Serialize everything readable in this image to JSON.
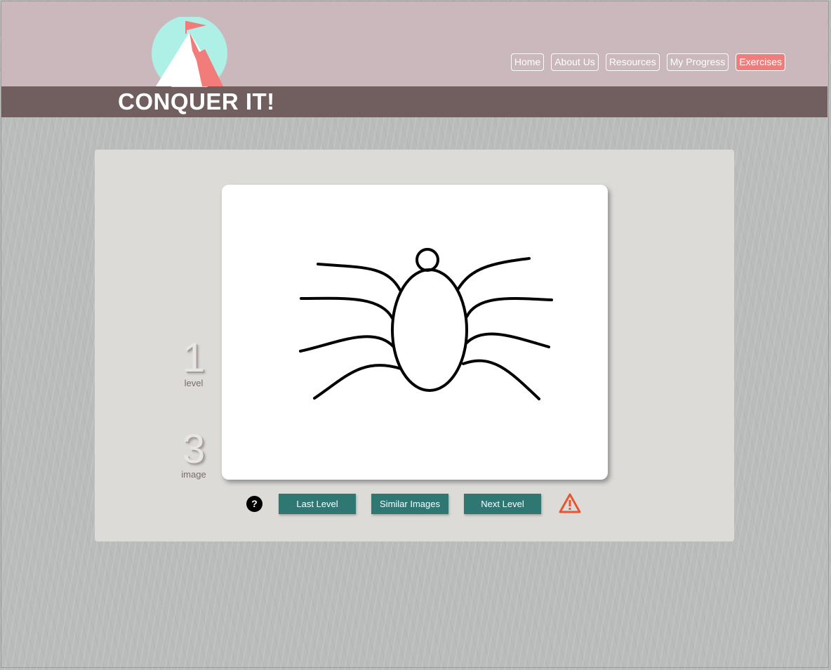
{
  "brand": {
    "name": "CONQUER IT!",
    "logo_icon": "mountain-flag-icon"
  },
  "nav": {
    "items": [
      {
        "label": "Home",
        "active": false
      },
      {
        "label": "About Us",
        "active": false
      },
      {
        "label": "Resources",
        "active": false
      },
      {
        "label": "My Progress",
        "active": false
      },
      {
        "label": "Exercises",
        "active": true
      }
    ]
  },
  "exercise": {
    "level": {
      "value": "1",
      "label": "level"
    },
    "image": {
      "value": "3",
      "label": "image"
    },
    "picture_icon": "spider-drawing",
    "help_label": "?",
    "buttons": {
      "last_level": "Last Level",
      "similar_images": "Similar Images",
      "next_level": "Next Level"
    },
    "report_icon": "warning-triangle-icon"
  },
  "colors": {
    "header_top": "#cbb8bd",
    "header_band": "#715e5f",
    "nav_active": "#f07c7c",
    "button": "#2e7772",
    "panel": "#dcdbd8",
    "logo_circle": "#aef0e6",
    "logo_mountain": "#f27c7a",
    "warning": "#e8552f"
  }
}
